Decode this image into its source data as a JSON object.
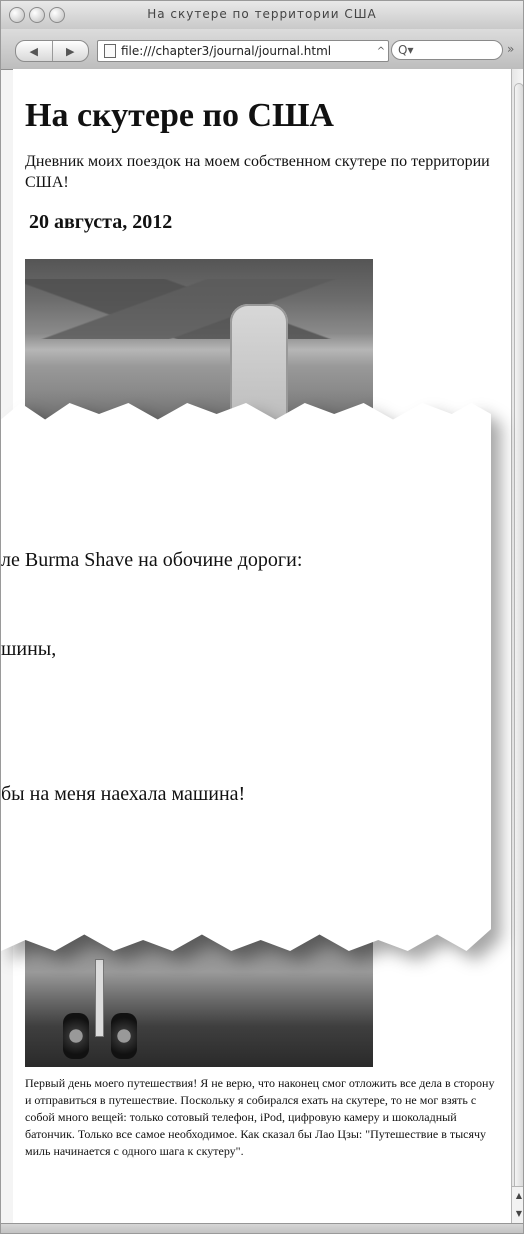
{
  "window": {
    "title": "На скутере по территории США",
    "url": "file:///chapter3/journal/journal.html",
    "search_placeholder": "Q▾",
    "nav_back": "◀",
    "nav_forward": "▶",
    "overflow": "»",
    "url_menu": "^",
    "scroll_up": "▲",
    "scroll_down": "▼"
  },
  "page": {
    "heading": "На скутере по США",
    "intro": "Дневник моих поездок на моем собственном скутере по территории США!",
    "date": "20 августа, 2012",
    "body_text": "Первый день моего путешествия! Я не верю, что наконец смог отложить все дела в сторону и отправиться в путешествие. Поскольку я собирался ехать на скутере, то не мог взять с собой много вещей: только сотовый телефон, iPod, цифровую камеру и шоколадный батончик. Только все самое необходимое. Как сказал бы Лао Цзы: \"Путешествие в тысячу миль начинается с одного шага к скутеру\"."
  },
  "zoom": {
    "line1": "ле Burma Shave на обочине дороги:",
    "line2": "шины,",
    "line3": "бы на меня наехала машина!"
  }
}
